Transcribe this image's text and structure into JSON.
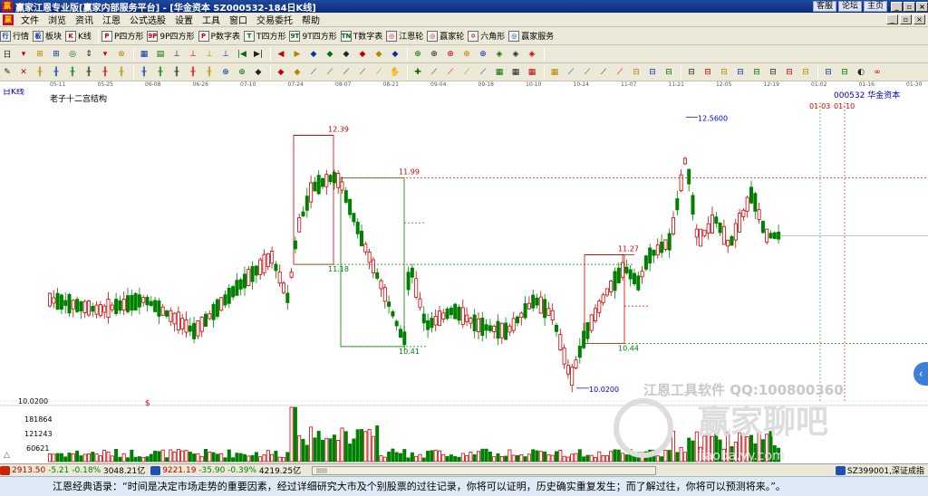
{
  "window": {
    "title": "赢家江恩专业版[赢家内部服务平台] - [华金资本  SZ000532-184日K线]",
    "links": [
      "客服",
      "论坛",
      "主页"
    ],
    "controls": [
      "_",
      "▫",
      "×"
    ]
  },
  "menu": [
    "文件",
    "浏览",
    "资讯",
    "江恩",
    "公式选股",
    "设置",
    "工具",
    "窗口",
    "交易委托",
    "帮助"
  ],
  "toolbar1": [
    {
      "icon": "行",
      "label": "行情"
    },
    {
      "icon": "板",
      "label": "板块"
    },
    {
      "icon": "K",
      "label": "K线"
    },
    {
      "icon": "P",
      "label": "P四方形"
    },
    {
      "icon": "9P",
      "label": "9P四方形"
    },
    {
      "icon": "P",
      "label": "P数字表"
    },
    {
      "icon": "T",
      "label": "T四方形"
    },
    {
      "icon": "9T",
      "label": "9T四方形"
    },
    {
      "icon": "TN",
      "label": "T数字表"
    },
    {
      "icon": "◎",
      "label": "江恩轮"
    },
    {
      "icon": "◎",
      "label": "赢家轮"
    },
    {
      "icon": "✡",
      "label": "六角形"
    },
    {
      "icon": "◎",
      "label": "赢家服务"
    }
  ],
  "toolbar2_tools": [
    "日",
    "▾",
    "⊞",
    "⊞",
    "◎",
    "⇕",
    "▾",
    "⊗",
    "▦",
    "▤",
    "⊥",
    "⊥",
    "⊥",
    "⊥",
    "|◀",
    "▶|",
    "◀",
    "▶",
    "◆",
    "◆",
    "◆",
    "◆",
    "◆",
    "◆",
    "⊕",
    "⊕",
    "⊕",
    "⊕",
    "⊕",
    "◈",
    "◈",
    "◈"
  ],
  "toolbar3_tools": [
    "✎",
    "✕",
    "╫",
    "╫",
    "╫",
    "╫",
    "╫",
    "╫",
    "╫",
    "╫",
    "╫",
    "╫",
    "╫",
    "⊕",
    "⊕",
    "◆",
    "◆",
    "◆",
    "⟋",
    "⟋",
    "⟋",
    "⟋",
    "⟋",
    "✋",
    "✚",
    "⟋",
    "⟋",
    "⟋",
    "⟋",
    "▦",
    "▦",
    "▦",
    "▦",
    "⟋",
    "⟋",
    "⟋",
    "⟋",
    "⊟",
    "⊟",
    "⊟",
    "⊟",
    "⊟",
    "⊟",
    "⊟",
    "⊟",
    "⊟",
    "⊟",
    "⊟",
    "⊟",
    "⊟",
    "◐",
    "∞"
  ],
  "dates": [
    "05-11",
    "05-25",
    "06-08",
    "06-26",
    "07-10",
    "07-24",
    "08-07",
    "08-21",
    "09-04",
    "09-18",
    "10-10",
    "10-24",
    "11-07",
    "11-21",
    "12-05",
    "12-19",
    "01-02",
    "01-16",
    "01-30"
  ],
  "chart_data": {
    "type": "candlestick",
    "period_label": "日K线",
    "subtitle": "老子十二宫结构",
    "stock": "000532  华金资本",
    "levels": [
      {
        "label": "12.39",
        "color": "#d00000"
      },
      {
        "label": "11.99",
        "color": "#d00000"
      },
      {
        "label": "11.18",
        "color": "#008000"
      },
      {
        "label": "11.27",
        "color": "#d00000"
      },
      {
        "label": "10.41",
        "color": "#008000"
      },
      {
        "label": "10.44",
        "color": "#008000"
      },
      {
        "label": "12.5600",
        "color": "#0000c0"
      },
      {
        "label": "10.0200",
        "color": "#0000c0"
      }
    ],
    "time_marks": [
      "01-03",
      "01-10"
    ],
    "volume_labels": [
      "181864",
      "121243",
      "60621"
    ],
    "price_scale_label": "10.0200",
    "y_price_range": [
      9.9,
      12.7
    ],
    "watermark_software": "江恩工具软件  QQ:100800360",
    "watermark_forum": "赢家聊吧",
    "watermark_url": "jiaoba.yy.com"
  },
  "statusbar": {
    "index1": {
      "value": "2913.50",
      "change": "-5.21",
      "pct": "-0.18%",
      "turnover": "3048.21亿"
    },
    "index2": {
      "value": "9221.19",
      "change": "-35.90",
      "pct": "-0.39%",
      "turnover": "4219.25亿"
    },
    "right_label": "SZ399001,深证成指"
  },
  "quote": "江恩经典语录：“时间是决定市场走势的重要因素，经过详细研究大市及个别股票的过往记录，你将可以证明，历史确实重复发生；而了解过往，你将可以预测将来。”。"
}
